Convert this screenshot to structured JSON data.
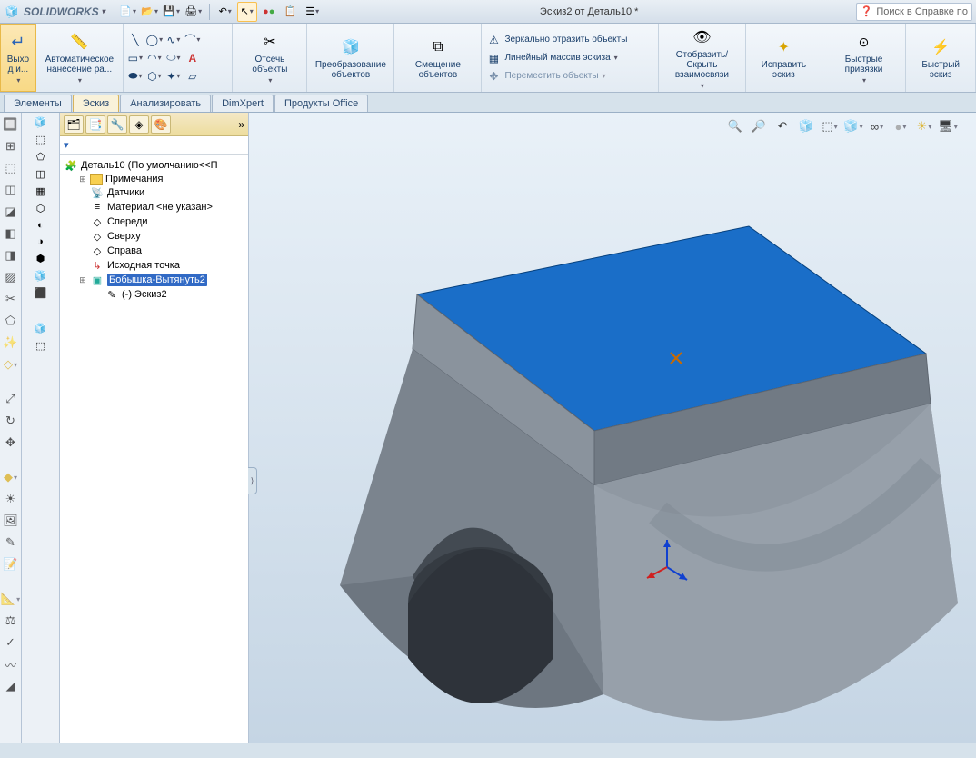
{
  "app": {
    "name": "SOLIDWORKS",
    "doc_title": "Эскиз2 от Деталь10 *",
    "search_placeholder": "Поиск в Справке по"
  },
  "ribbon": {
    "exit": {
      "label": "Выхо д и..."
    },
    "autodim": {
      "label": "Автоматическое нанесение ра..."
    },
    "trim": {
      "label": "Отсечь объекты"
    },
    "convert": {
      "label": "Преобразование объектов"
    },
    "offset": {
      "label": "Смещение объектов"
    },
    "mirror": "Зеркально отразить объекты",
    "linear": "Линейный массив эскиза",
    "move": "Переместить объекты",
    "disp_rel": {
      "label": "Отобразить/Скрыть взаимосвязи"
    },
    "repair": {
      "label": "Исправить эскиз"
    },
    "snaps": {
      "label": "Быстрые привязки"
    },
    "quick": {
      "label": "Быстрый эскиз"
    }
  },
  "tabs": {
    "elements": "Элементы",
    "sketch": "Эскиз",
    "analyze": "Анализировать",
    "dimxpert": "DimXpert",
    "office": "Продукты Office"
  },
  "tree": {
    "root": "Деталь10  (По умолчанию<<П",
    "items": [
      "Примечания",
      "Датчики",
      "Материал <не указан>",
      "Спереди",
      "Сверху",
      "Справа",
      "Исходная точка",
      "Бобышка-Вытянуть2",
      "(-) Эскиз2"
    ]
  }
}
